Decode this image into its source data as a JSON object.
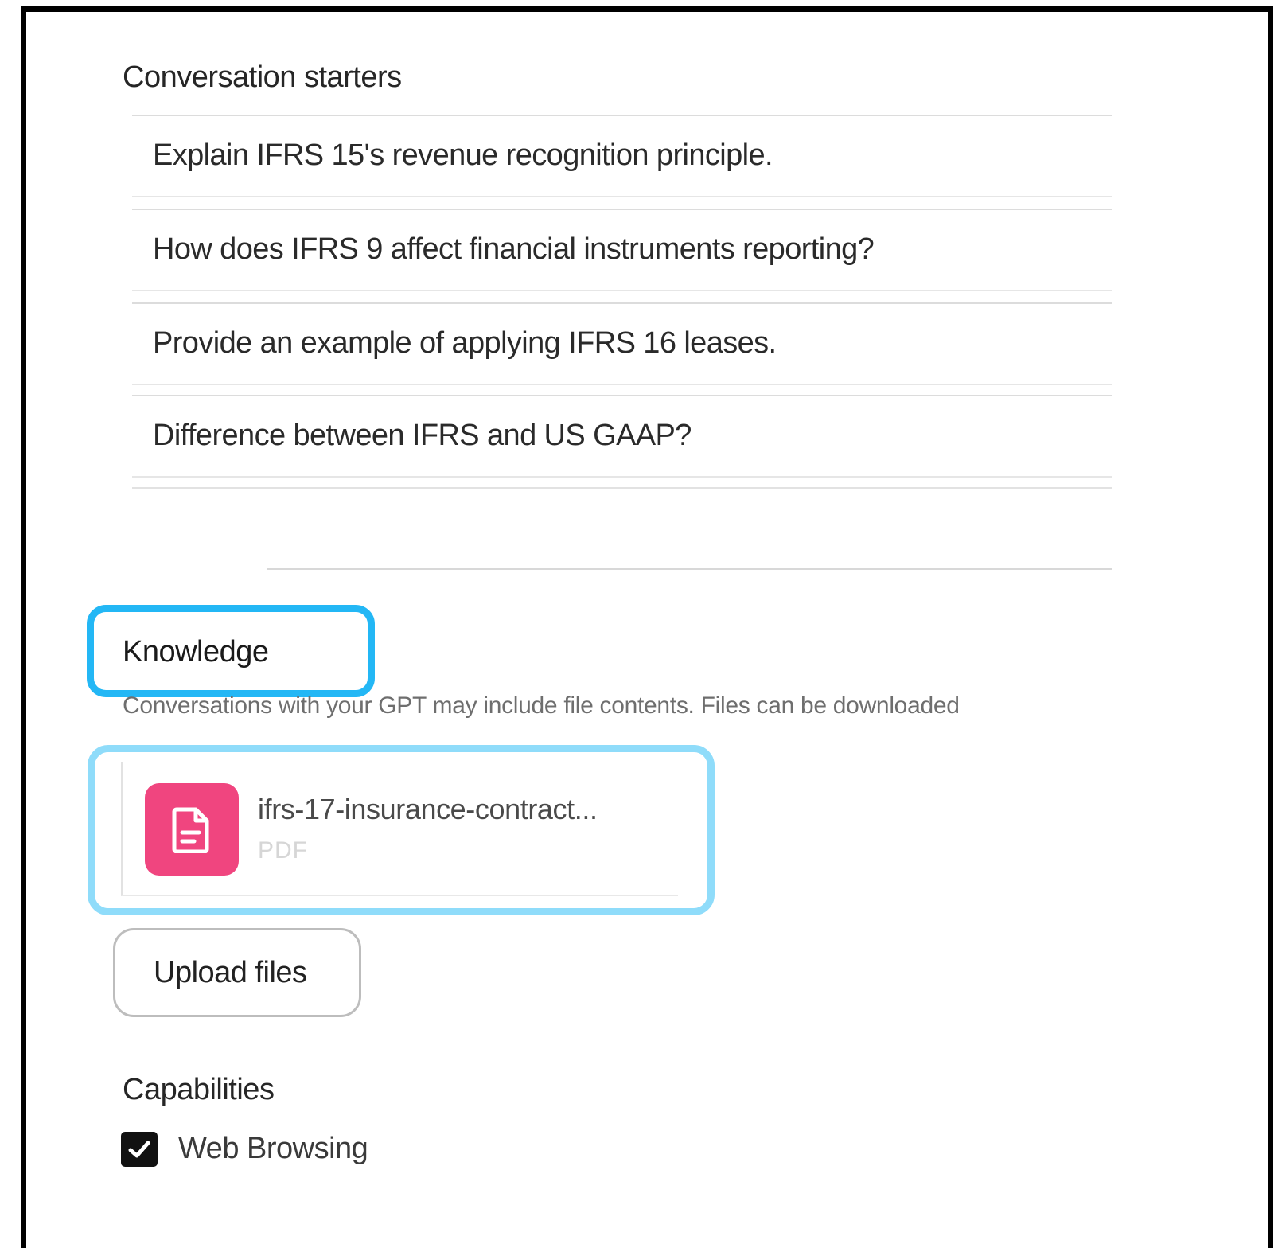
{
  "conversation_starters": {
    "label": "Conversation starters",
    "items": [
      "Explain IFRS 15's revenue recognition principle.",
      "How does IFRS 9 affect financial instruments reporting?",
      "Provide an example of applying IFRS 16 leases.",
      "Difference between IFRS and US GAAP?",
      ""
    ]
  },
  "knowledge": {
    "label": "Knowledge",
    "description": "Conversations with your GPT may include file contents. Files can be downloaded",
    "file": {
      "name": "ifrs-17-insurance-contract...",
      "type": "PDF",
      "icon": "document-icon",
      "icon_color": "#f0457f"
    },
    "upload_label": "Upload files"
  },
  "capabilities": {
    "label": "Capabilities",
    "items": [
      {
        "label": "Web Browsing",
        "checked": true
      }
    ]
  },
  "colors": {
    "highlight_primary": "#23b7f5",
    "highlight_secondary": "#8fdcfa"
  }
}
